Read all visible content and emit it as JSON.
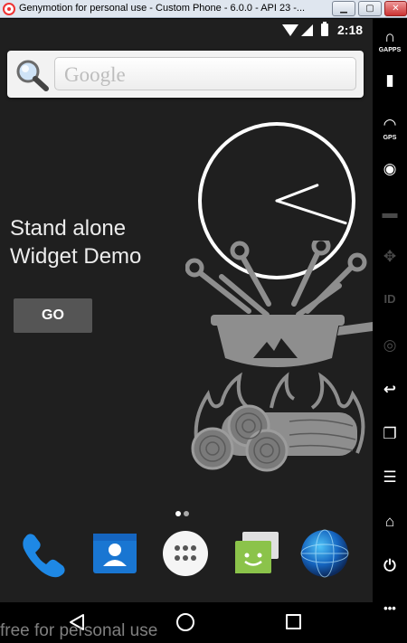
{
  "window": {
    "title": "Genymotion for personal use - Custom Phone - 6.0.0 - API 23 -...",
    "min_glyph": "▁",
    "max_glyph": "▢",
    "close_glyph": "✕"
  },
  "status_bar": {
    "time": "2:18"
  },
  "search_widget": {
    "placeholder": "Google"
  },
  "widget_demo": {
    "title": "Stand alone Widget Demo",
    "button_label": "GO"
  },
  "clock": {
    "hour": 2,
    "minute": 18
  },
  "home": {
    "page_count": 2,
    "current_page": 0
  },
  "dock": [
    {
      "name": "phone-icon"
    },
    {
      "name": "contacts-icon"
    },
    {
      "name": "app-drawer-icon"
    },
    {
      "name": "messenger-icon"
    },
    {
      "name": "browser-icon"
    }
  ],
  "watermark": "free for personal use",
  "sidebar": {
    "tools": [
      {
        "name": "gapps-icon",
        "label": "GAPPS",
        "glyph": "∩",
        "enabled": true
      },
      {
        "name": "battery-icon",
        "label": "",
        "glyph": "▮",
        "enabled": true
      },
      {
        "name": "gps-icon",
        "label": "GPS",
        "glyph": "◠",
        "enabled": true
      },
      {
        "name": "webcam-icon",
        "label": "",
        "glyph": "◉",
        "enabled": true
      },
      {
        "name": "screencast-icon",
        "label": "",
        "glyph": "▬",
        "enabled": false
      },
      {
        "name": "dpad-icon",
        "label": "",
        "glyph": "✥",
        "enabled": false
      },
      {
        "name": "identifiers-icon",
        "label": "",
        "glyph": "ID",
        "enabled": false
      },
      {
        "name": "disk-icon",
        "label": "",
        "glyph": "◎",
        "enabled": false
      },
      {
        "name": "back-nav-icon",
        "label": "",
        "glyph": "↩",
        "enabled": true
      },
      {
        "name": "recent-apps-icon",
        "label": "",
        "glyph": "❐",
        "enabled": true
      },
      {
        "name": "menu-icon",
        "label": "",
        "glyph": "☰",
        "enabled": true
      },
      {
        "name": "home-nav-icon",
        "label": "",
        "glyph": "⌂",
        "enabled": true
      },
      {
        "name": "power-icon",
        "label": "",
        "glyph": "⏻",
        "enabled": true
      },
      {
        "name": "more-icon",
        "label": "",
        "glyph": "•••",
        "enabled": true
      }
    ]
  }
}
